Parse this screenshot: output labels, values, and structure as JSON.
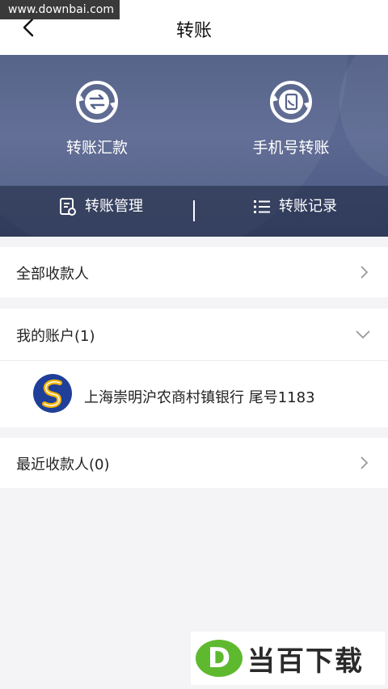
{
  "watermark_top": "www.downbai.com",
  "nav": {
    "title": "转账"
  },
  "hero": {
    "actions": [
      {
        "label": "转账汇款",
        "icon": "transfer-arrows-icon"
      },
      {
        "label": "手机号转账",
        "icon": "phone-transfer-icon"
      }
    ],
    "bar": [
      {
        "label": "转账管理",
        "icon": "document-gear-icon"
      },
      {
        "label": "转账记录",
        "icon": "list-icon"
      }
    ]
  },
  "sections": {
    "all_payees": "全部收款人",
    "my_accounts": "我的账户(1)",
    "account_item": "上海崇明沪农商村镇银行 尾号1183",
    "recent_payees": "最近收款人(0)"
  },
  "watermark_bottom": {
    "logo": "D",
    "text": "当百下载"
  },
  "colors": {
    "hero_bg": "#56638c",
    "bank_logo_blue": "#1f3f99",
    "bank_logo_yellow": "#f4b400",
    "watermark_green": "#5fb92f"
  }
}
